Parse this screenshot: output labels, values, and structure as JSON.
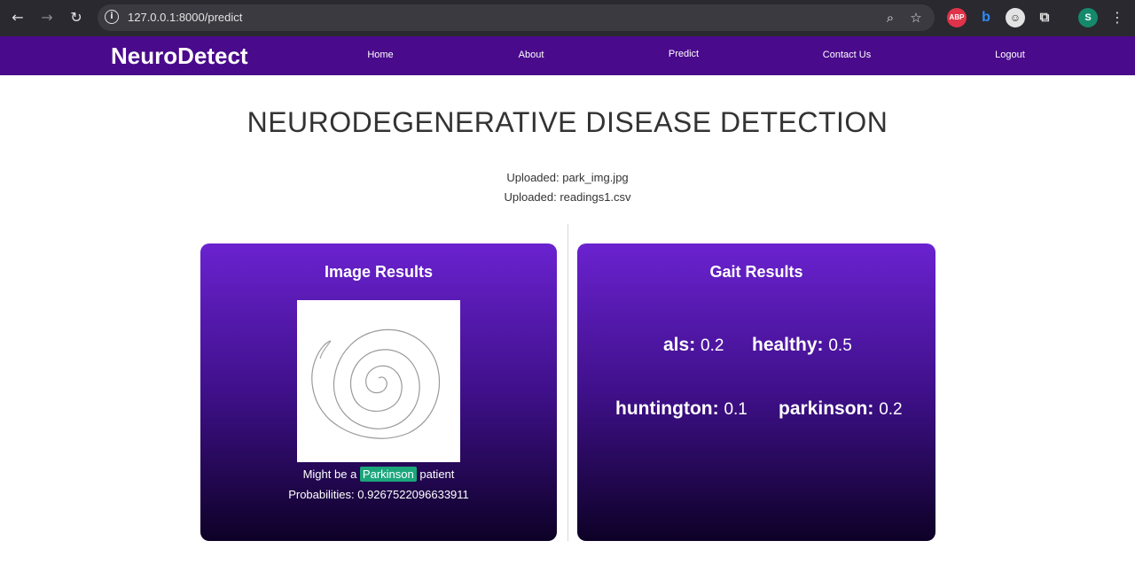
{
  "browser": {
    "url": "127.0.0.1:8000/predict",
    "back_icon": "arrow-left-icon",
    "forward_icon": "arrow-right-icon",
    "reload_icon": "reload-icon",
    "profile_initial": "S",
    "abp_label": "ABP"
  },
  "navbar": {
    "brand": "NeuroDetect",
    "links": [
      "Home",
      "About",
      "Predict",
      "Contact Us",
      "Logout"
    ],
    "background": "#4a0a8c"
  },
  "main": {
    "title": "NEURODEGENERATIVE DISEASE DETECTION",
    "uploaded_image": "Uploaded: park_img.jpg",
    "uploaded_csv": "Uploaded: readings1.csv"
  },
  "image_results": {
    "title": "Image Results",
    "prefix": "Might be a",
    "label": "Parkinson",
    "suffix": "patient",
    "probabilities": "Probabilities: 0.9267522096633911",
    "badge_color": "#1aa67a"
  },
  "gait_results": {
    "title": "Gait Results",
    "items": [
      {
        "key": "als:",
        "value": "0.2"
      },
      {
        "key": "healthy:",
        "value": "0.5"
      },
      {
        "key": "huntington:",
        "value": "0.1"
      },
      {
        "key": "parkinson:",
        "value": "0.2"
      }
    ]
  }
}
